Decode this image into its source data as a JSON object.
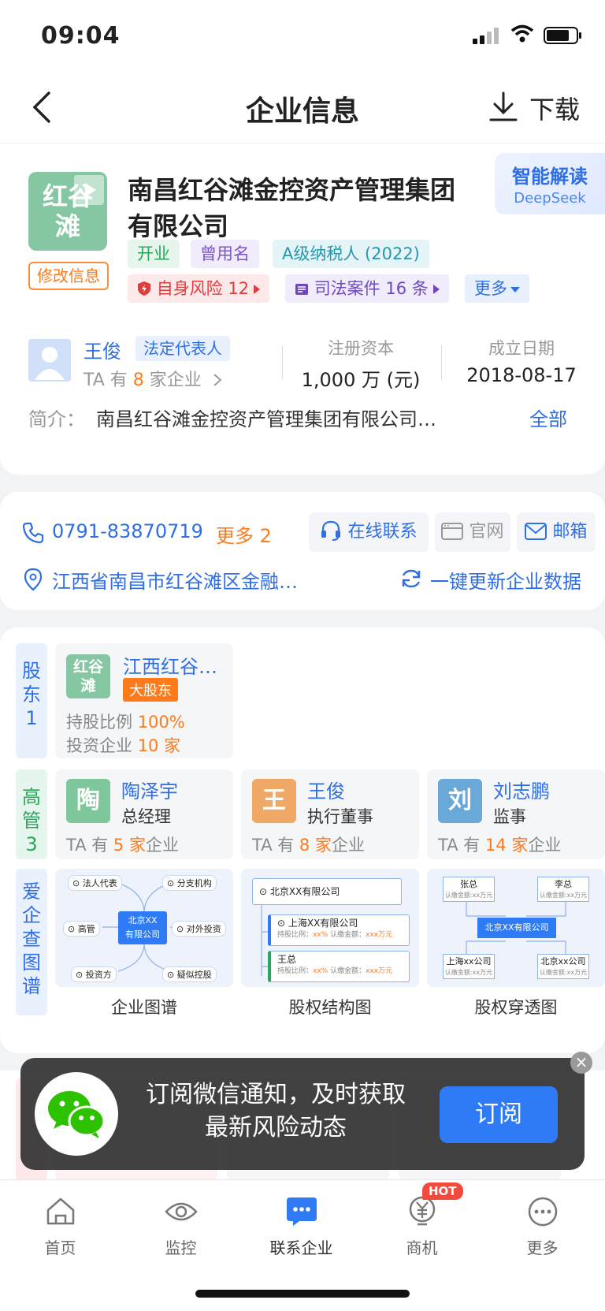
{
  "status": {
    "time": "09:04"
  },
  "nav": {
    "title": "企业信息",
    "download": "下载"
  },
  "company": {
    "logo_text_1": "红谷",
    "logo_text_2": "滩",
    "edit_label": "修改信息",
    "name": "南昌红谷滩金控资产管理集团有限公司",
    "ai_title": "智能解读",
    "ai_sub": "DeepSeek",
    "tags": [
      "开业",
      "曾用名",
      "A级纳税人 (2022)"
    ],
    "risk_tags": {
      "self_risk": "自身风险 12",
      "judicial": "司法案件 16 条",
      "more": "更多"
    },
    "legal_rep": {
      "name": "王俊",
      "tag": "法定代表人",
      "ta_prefix": "TA 有 ",
      "count": "8",
      "ta_suffix": " 家企业"
    },
    "capital": {
      "label": "注册资本",
      "value": "1,000 万 (元)"
    },
    "founded": {
      "label": "成立日期",
      "value": "2018-08-17"
    },
    "intro": {
      "label": "简介：",
      "text": "南昌红谷滩金控资产管理集团有限公司…",
      "all": "全部"
    }
  },
  "contact": {
    "phone": "0791-83870719",
    "phone_more": "更多 2",
    "online": "在线联系",
    "website": "官网",
    "email": "邮箱",
    "address": "江西省南昌市红谷滩区金融…",
    "refresh": "一键更新企业数据"
  },
  "relations": {
    "shareholder_side": [
      "股",
      "东",
      "1"
    ],
    "shareholder": {
      "logo_1": "红谷",
      "logo_2": "滩",
      "name": "江西红谷…",
      "tag": "大股东",
      "ratio_label": "持股比例 ",
      "ratio": "100%",
      "invest_label": "投资企业 ",
      "invest": "10 家"
    },
    "exec_side": [
      "高",
      "管",
      "3"
    ],
    "execs": [
      {
        "char": "陶",
        "name": "陶泽宇",
        "role": "总经理",
        "ta_prefix": "TA 有 ",
        "count": "5 家",
        "ta_suffix": "企业",
        "color": "#7fc79a"
      },
      {
        "char": "王",
        "name": "王俊",
        "role": "执行董事",
        "ta_prefix": "TA 有 ",
        "count": "8 家",
        "ta_suffix": "企业",
        "color": "#f0a866"
      },
      {
        "char": "刘",
        "name": "刘志鹏",
        "role": "监事",
        "ta_prefix": "TA 有 ",
        "count": "14 家",
        "ta_suffix": "企业",
        "color": "#6aa8d8"
      }
    ],
    "graph_side": [
      "爱",
      "企",
      "查",
      "图",
      "谱"
    ],
    "graphs": [
      {
        "caption": "企业图谱",
        "center": [
          "北京XX",
          "有限公司"
        ],
        "nodes": [
          "法人代表",
          "分支机构",
          "高管",
          "对外投资",
          "投资方",
          "疑似控股"
        ]
      },
      {
        "caption": "股权结构图",
        "top": "北京XX有限公司",
        "sub1": "上海XX有限公司",
        "sub2": "王总",
        "detail_label_1": "持股比例：",
        "detail_value_1": "xx%",
        "detail_label_2": "认缴金额：",
        "detail_value_2": "xxx万元"
      },
      {
        "caption": "股权穿透图",
        "center": "北京XX有限公司",
        "tl": "张总",
        "tr": "李总",
        "bl": "上海xx公司",
        "br": "北京xx公司",
        "amount": "认缴金额:xx万元"
      }
    ]
  },
  "toast": {
    "text": "订阅微信通知，及时获取最新风险动态",
    "button": "订阅",
    "close": "×"
  },
  "tabbar": {
    "items": [
      "首页",
      "监控",
      "联系企业",
      "商机",
      "更多"
    ],
    "hot": "HOT"
  },
  "colors": {
    "brand_blue": "#2f6fe5",
    "accent_orange": "#ff7a1a"
  }
}
